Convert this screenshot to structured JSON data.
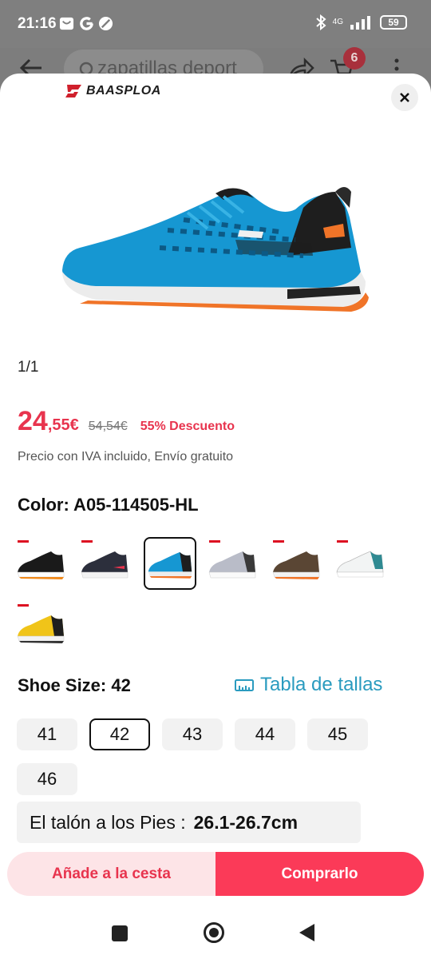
{
  "status_bar": {
    "time": "21:16",
    "network": "4G",
    "battery": "59"
  },
  "background_page": {
    "search_text": "zapatillas deport",
    "cart_badge": "6"
  },
  "brand": {
    "name": "BAASPLOA"
  },
  "gallery": {
    "counter": "1/1"
  },
  "price": {
    "integer": "24",
    "decimal": ",55€",
    "original": "54,54€",
    "discount": "55% Descuento",
    "tax_note": "Precio con IVA incluido, Envío gratuito",
    "accent_color": "#e8344e"
  },
  "color": {
    "label": "Color: A05-114505-HL",
    "swatches": [
      {
        "name": "black-orange",
        "selected": false
      },
      {
        "name": "navy-white",
        "selected": false
      },
      {
        "name": "blue-black",
        "selected": true
      },
      {
        "name": "grey-white",
        "selected": false
      },
      {
        "name": "brown-orange",
        "selected": false
      },
      {
        "name": "white-teal",
        "selected": false
      },
      {
        "name": "yellow-black",
        "selected": false
      }
    ]
  },
  "size": {
    "label": "Shoe Size: 42",
    "chart_link": "Tabla de tallas",
    "options": [
      "41",
      "42",
      "43",
      "44",
      "45",
      "46"
    ],
    "selected": "42",
    "measure_label": "El talón a los Pies :",
    "measure_value": "26.1-26.7cm"
  },
  "actions": {
    "add_to_cart": "Añade a la cesta",
    "buy_now": "Comprarlo",
    "buy_color": "#fb3a58"
  }
}
